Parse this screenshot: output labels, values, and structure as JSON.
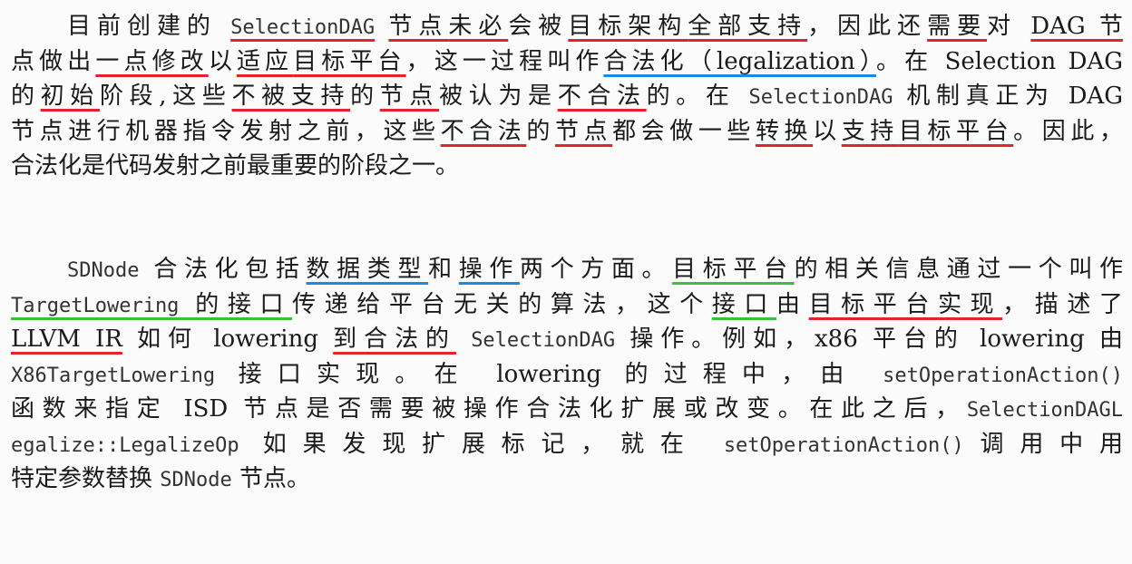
{
  "colors": {
    "red_underline": "#e3242b",
    "blue_underline": "#1e88e5",
    "green_underline": "#3cbf3c",
    "text": "#1a1a1a"
  },
  "paragraphs": [
    {
      "lines": [
        [
          {
            "t": "目前创建的 ",
            "f": "t"
          },
          {
            "t": "SelectionDAG",
            "f": "m",
            "u": "red"
          },
          {
            "t": " ",
            "f": "t"
          },
          {
            "t": "节点",
            "f": "t",
            "u": "red"
          },
          {
            "t": "未必",
            "f": "t",
            "u": "red"
          },
          {
            "t": "会被",
            "f": "t"
          },
          {
            "t": "目标架构",
            "f": "t",
            "u": "red"
          },
          {
            "t": "全部支持",
            "f": "t",
            "u": "red"
          },
          {
            "t": "，因此还",
            "f": "t"
          },
          {
            "t": "需要",
            "f": "t",
            "u": "red"
          },
          {
            "t": "对 ",
            "f": "t"
          },
          {
            "t": "DAG 节",
            "f": "t",
            "u": "red"
          }
        ],
        [
          {
            "t": "点做出",
            "f": "t"
          },
          {
            "t": "一点修改",
            "f": "t",
            "u": "red"
          },
          {
            "t": "以",
            "f": "t"
          },
          {
            "t": "适应",
            "f": "t",
            "u": "red"
          },
          {
            "t": "目标平台",
            "f": "t",
            "u": "red"
          },
          {
            "t": "，这一过程叫作",
            "f": "t"
          },
          {
            "t": "合法化（legalization）",
            "f": "t",
            "u": "blue"
          },
          {
            "t": "。在 Selection DAG",
            "f": "t"
          }
        ],
        [
          {
            "t": "的",
            "f": "t"
          },
          {
            "t": "初始",
            "f": "t",
            "u": "red"
          },
          {
            "t": "阶段,这些",
            "f": "t"
          },
          {
            "t": "不被支持",
            "f": "t",
            "u": "red"
          },
          {
            "t": "的",
            "f": "t"
          },
          {
            "t": "节点",
            "f": "t",
            "u": "red"
          },
          {
            "t": "被认为是",
            "f": "t"
          },
          {
            "t": "不合法",
            "f": "t",
            "u": "red"
          },
          {
            "t": "的。在 ",
            "f": "t"
          },
          {
            "t": "SelectionDAG",
            "f": "m"
          },
          {
            "t": " 机制真正为 DAG",
            "f": "t"
          }
        ],
        [
          {
            "t": "节点进行机器指令发射之前，这些",
            "f": "t"
          },
          {
            "t": "不合法",
            "f": "t",
            "u": "red"
          },
          {
            "t": "的",
            "f": "t"
          },
          {
            "t": "节点",
            "f": "t",
            "u": "red"
          },
          {
            "t": "都会做一些",
            "f": "t"
          },
          {
            "t": "转换",
            "f": "t",
            "u": "red"
          },
          {
            "t": "以",
            "f": "t"
          },
          {
            "t": "支持",
            "f": "t",
            "u": "red"
          },
          {
            "t": "目标平台",
            "f": "t",
            "u": "red"
          },
          {
            "t": "。因此，",
            "f": "t"
          }
        ],
        [
          {
            "t": "合法化是代码发射之前最重要的阶段之一。",
            "f": "t"
          }
        ]
      ]
    },
    {
      "lines": [
        [
          {
            "t": "SDNode",
            "f": "m"
          },
          {
            "t": " 合法化包括",
            "f": "t"
          },
          {
            "t": "数据类型",
            "f": "t",
            "u": "blue"
          },
          {
            "t": "和",
            "f": "t"
          },
          {
            "t": "操作",
            "f": "t",
            "u": "blue"
          },
          {
            "t": "两个方面。",
            "f": "t"
          },
          {
            "t": "目标平台",
            "f": "t",
            "u": "green"
          },
          {
            "t": "的相关信息通过一个叫作",
            "f": "t"
          }
        ],
        [
          {
            "t": "TargetLowering",
            "f": "m",
            "u": "green"
          },
          {
            "t": " 的接口",
            "f": "t",
            "u": "green"
          },
          {
            "t": "传递给平台无关的算法，这个",
            "f": "t"
          },
          {
            "t": "接口",
            "f": "t",
            "u": "green"
          },
          {
            "t": "由",
            "f": "t"
          },
          {
            "t": "目标平台",
            "f": "t",
            "u": "red"
          },
          {
            "t": "实现",
            "f": "t",
            "u": "red"
          },
          {
            "t": "，描述了",
            "f": "t"
          }
        ],
        [
          {
            "t": "LLVM IR",
            "f": "t",
            "u": "red"
          },
          {
            "t": " 如何 lowering ",
            "f": "t"
          },
          {
            "t": "到",
            "f": "t",
            "u": "red"
          },
          {
            "t": "合法的",
            "f": "t",
            "u": "red"
          },
          {
            "t": " ",
            "f": "t"
          },
          {
            "t": "SelectionDAG",
            "f": "m"
          },
          {
            "t": " 操作。例如，x86 平台的 lowering 由",
            "f": "t"
          }
        ],
        [
          {
            "t": "X86TargetLowering",
            "f": "m"
          },
          {
            "t": " 接口实现。在 lowering 的过程中，由 ",
            "f": "t"
          },
          {
            "t": "setOperationAction()",
            "f": "m"
          }
        ],
        [
          {
            "t": "函数来指定 ISD 节点是否需要被操作合法化扩展或改变。在此之后，",
            "f": "t"
          },
          {
            "t": "SelectionDAGL",
            "f": "m"
          }
        ],
        [
          {
            "t": "egalize::LegalizeOp",
            "f": "m"
          },
          {
            "t": " 如果发现扩展标记，就在 ",
            "f": "t"
          },
          {
            "t": "setOperationAction()",
            "f": "m"
          },
          {
            "t": "调用中用",
            "f": "t"
          }
        ],
        [
          {
            "t": "特定参数替换 ",
            "f": "t"
          },
          {
            "t": "SDNode",
            "f": "m"
          },
          {
            "t": " 节点。",
            "f": "t"
          }
        ]
      ]
    }
  ]
}
